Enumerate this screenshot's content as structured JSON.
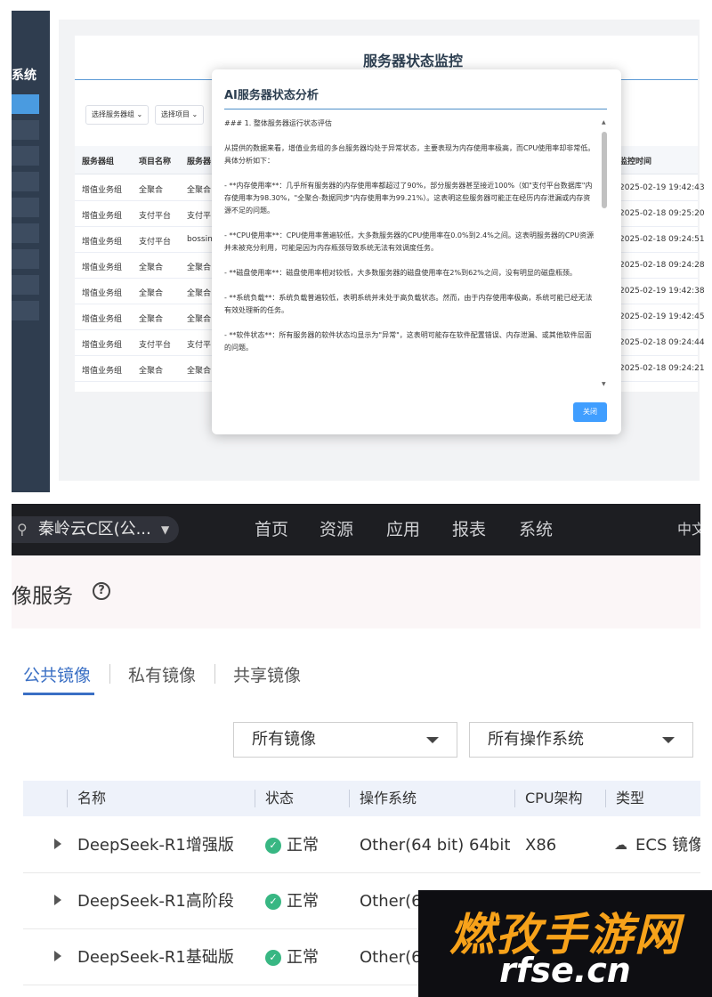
{
  "monitor": {
    "sidebar_title": "系统",
    "page_title": "服务器状态监控",
    "filters": [
      "选择服务器组",
      "选择项目"
    ],
    "columns": [
      "服务器组",
      "项目名称",
      "服务器",
      "监控时间"
    ],
    "rows": [
      {
        "group": "增值业务组",
        "project": "全聚合",
        "server": "全聚合",
        "time": "2025-02-19 19:42:43"
      },
      {
        "group": "增值业务组",
        "project": "支付平台",
        "server": "支付平",
        "time": "2025-02-18 09:25:20"
      },
      {
        "group": "增值业务组",
        "project": "支付平台",
        "server": "bossin",
        "time": "2025-02-18 09:24:51"
      },
      {
        "group": "增值业务组",
        "project": "全聚合",
        "server": "全聚合",
        "time": "2025-02-18 09:24:28"
      },
      {
        "group": "增值业务组",
        "project": "全聚合",
        "server": "全聚合",
        "time": "2025-02-19 19:42:38"
      },
      {
        "group": "增值业务组",
        "project": "全聚合",
        "server": "全聚合",
        "time": "2025-02-19 19:42:45"
      },
      {
        "group": "增值业务组",
        "project": "支付平台",
        "server": "支付平",
        "time": "2025-02-18 09:24:44"
      },
      {
        "group": "增值业务组",
        "project": "全聚合",
        "server": "全聚合",
        "time": "2025-02-18 09:24:21"
      }
    ],
    "dialog": {
      "title": "AI服务器状态分析",
      "paragraphs": [
        "### 1. 整体服务器运行状态评估",
        "从提供的数据来看，增值业务组的多台服务器均处于异常状态，主要表现为内存使用率极高，而CPU使用率却非常低。具体分析如下：",
        "- **内存使用率**：几乎所有服务器的内存使用率都超过了90%，部分服务器甚至接近100%（如\"支付平台数据库\"内存使用率为98.30%，\"全聚合-数据同步\"内存使用率为99.21%）。这表明这些服务器可能正在经历内存泄漏或内存资源不足的问题。",
        "- **CPU使用率**：CPU使用率普遍较低，大多数服务器的CPU使用率在0.0%到2.4%之间。这表明服务器的CPU资源并未被充分利用，可能是因为内存瓶颈导致系统无法有效调度任务。",
        "- **磁盘使用率**：磁盘使用率相对较低，大多数服务器的磁盘使用率在2%到62%之间，没有明显的磁盘瓶颈。",
        "- **系统负载**：系统负载普遍较低，表明系统并未处于高负载状态。然而，由于内存使用率极高，系统可能已经无法有效处理新的任务。",
        "- **软件状态**：所有服务器的软件状态均显示为\"异常\"，这表明可能存在软件配置错误、内存泄漏、或其他软件层面的问题。"
      ],
      "close_label": "关闭"
    }
  },
  "cloud": {
    "region": "秦岭云C区(公...",
    "nav": [
      "首页",
      "资源",
      "应用",
      "报表",
      "系统"
    ],
    "lang": "中文",
    "service_title": "像服务",
    "help_glyph": "?",
    "tabs": [
      "公共镜像",
      "私有镜像",
      "共享镜像"
    ],
    "selects": [
      "所有镜像",
      "所有操作系统"
    ],
    "columns": [
      "名称",
      "状态",
      "操作系统",
      "CPU架构",
      "类型"
    ],
    "rows": [
      {
        "name": "DeepSeek-R1增强版",
        "status": "正常",
        "os": "Other(64 bit) 64bit",
        "arch": "X86",
        "type": "ECS 镜像"
      },
      {
        "name": "DeepSeek-R1高阶段",
        "status": "正常",
        "os": "Other(64",
        "arch": "",
        "type": ""
      },
      {
        "name": "DeepSeek-R1基础版",
        "status": "正常",
        "os": "Other(64",
        "arch": "",
        "type": ""
      }
    ],
    "status_color": "#38b783",
    "accent": "#3a6fc4"
  },
  "watermark": {
    "logo": "燃孜手游网",
    "url": "rfse.cn"
  }
}
